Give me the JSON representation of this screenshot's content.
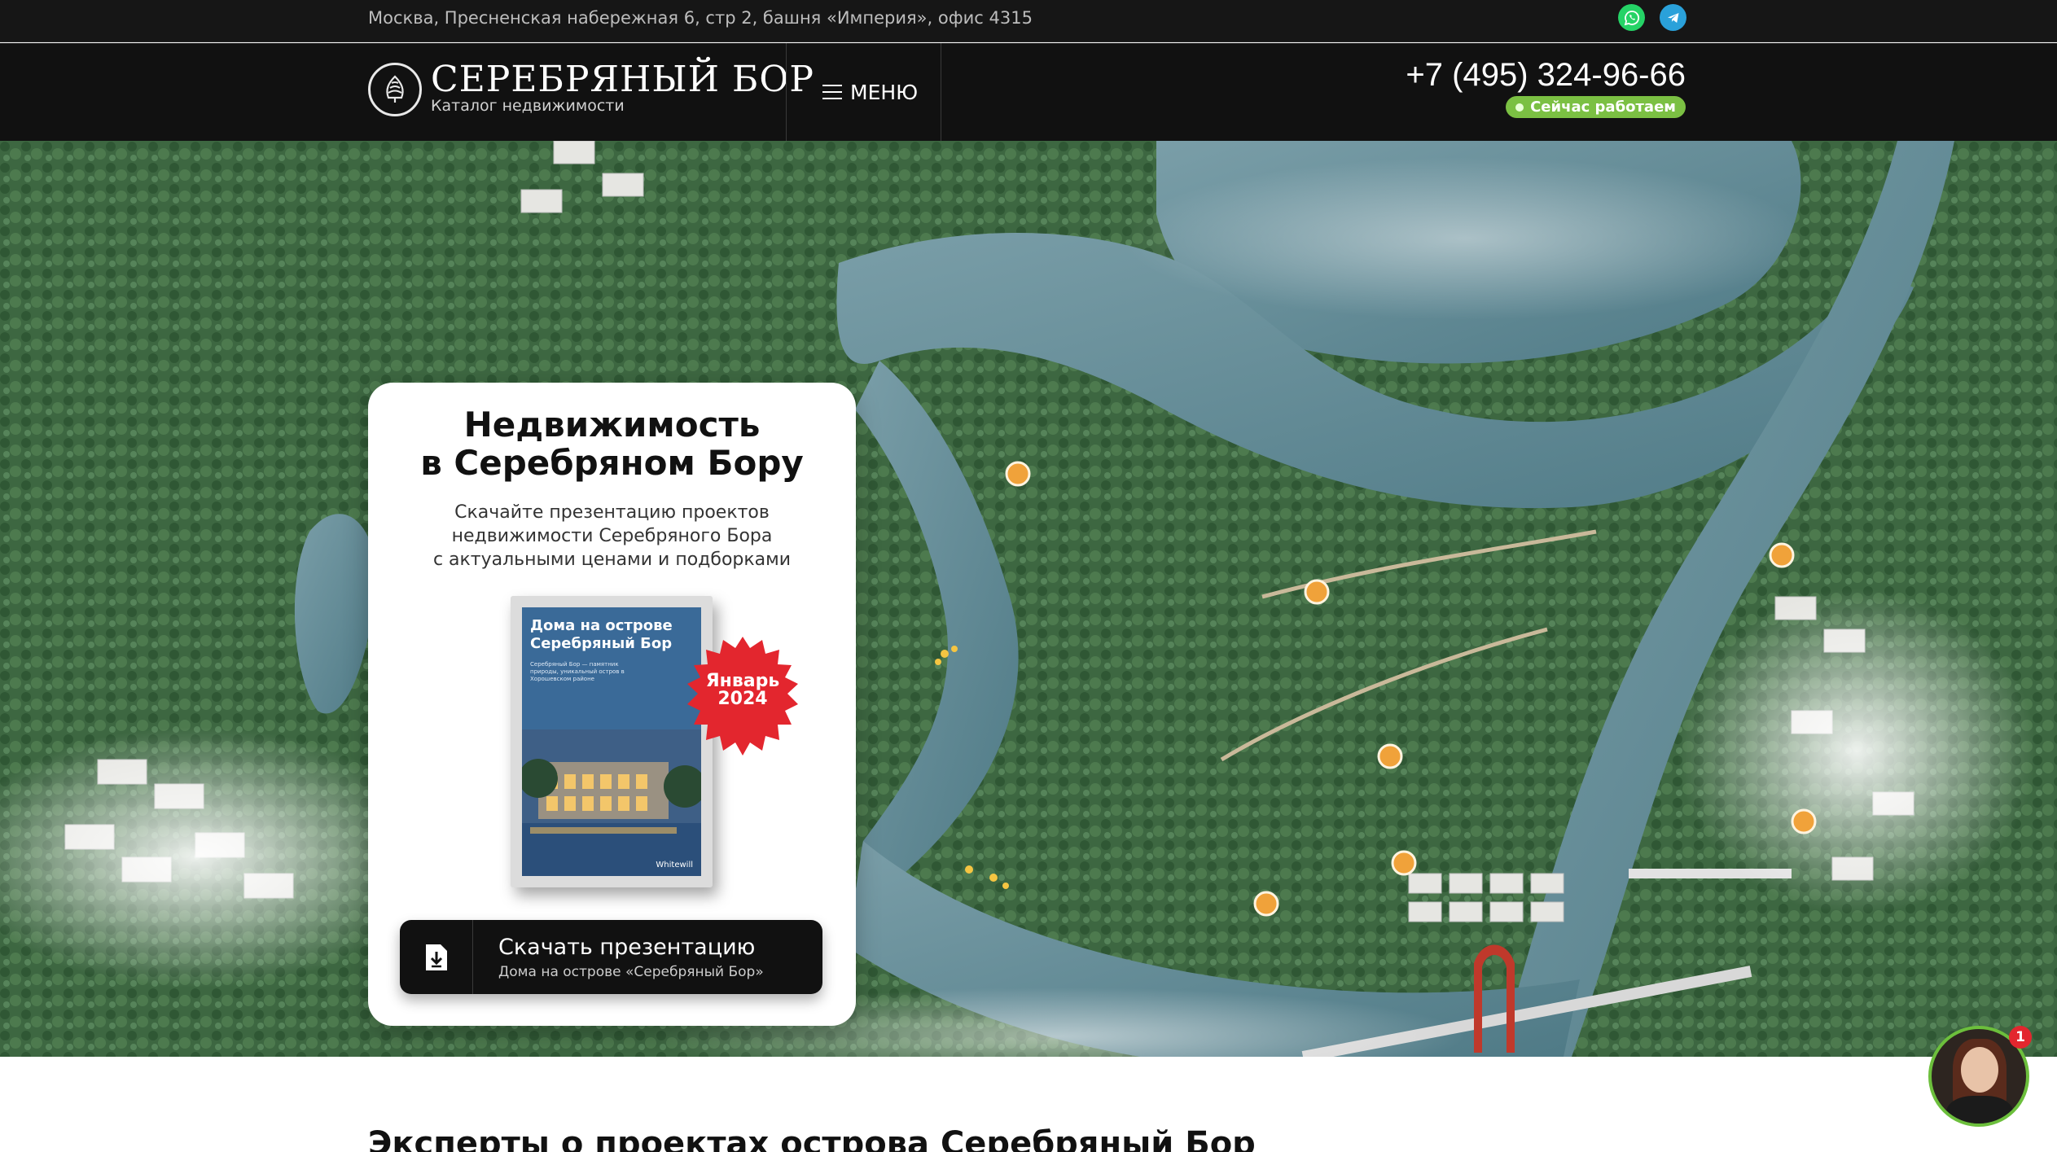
{
  "topbar": {
    "address": "Москва, Пресненская набережная 6, стр 2, башня «Империя», офис 4315",
    "icons": {
      "whatsapp": "whatsapp-icon",
      "telegram": "telegram-icon"
    }
  },
  "header": {
    "brand": "СЕРЕБРЯНЫЙ БОР",
    "brand_sub": "Каталог недвижимости",
    "menu_label": "МЕНЮ",
    "phone": "+7 (495) 324-96-66",
    "status": "Сейчас работаем"
  },
  "hero": {
    "card": {
      "title_line1": "Недвижимость",
      "title_line2": "в Серебряном Бору",
      "desc_line1": "Скачайте презентацию проектов",
      "desc_line2": "недвижимости Серебряного Бора",
      "desc_line3": "с актуальными ценами и подборками",
      "book": {
        "title": "Дома на острове Серебряный Бор",
        "text": "Серебряный Бор — памятник природы, уникальный остров в Хорошевском районе",
        "brand": "Whitewill"
      },
      "badge_line1": "Январь",
      "badge_line2": "2024",
      "download": {
        "label": "Скачать презентацию",
        "sub": "Дома на острове «Серебряный Бор»"
      }
    }
  },
  "section": {
    "title": "Эксперты о проектах острова Серебряный Бор"
  },
  "chat": {
    "unread": "1"
  },
  "colors": {
    "dark_bg": "#111111",
    "status_green": "#7bc043",
    "marker_orange": "#f0a23a",
    "badge_red": "#e3262e"
  }
}
